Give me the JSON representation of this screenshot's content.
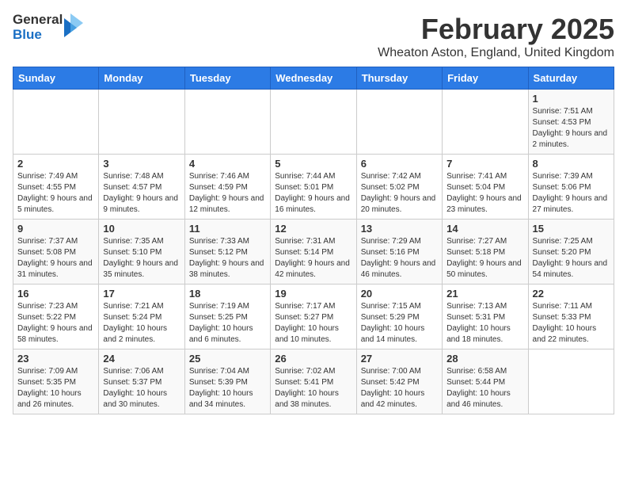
{
  "header": {
    "logo_general": "General",
    "logo_blue": "Blue",
    "month_title": "February 2025",
    "location": "Wheaton Aston, England, United Kingdom"
  },
  "weekdays": [
    "Sunday",
    "Monday",
    "Tuesday",
    "Wednesday",
    "Thursday",
    "Friday",
    "Saturday"
  ],
  "weeks": [
    [
      {
        "day": "",
        "info": ""
      },
      {
        "day": "",
        "info": ""
      },
      {
        "day": "",
        "info": ""
      },
      {
        "day": "",
        "info": ""
      },
      {
        "day": "",
        "info": ""
      },
      {
        "day": "",
        "info": ""
      },
      {
        "day": "1",
        "info": "Sunrise: 7:51 AM\nSunset: 4:53 PM\nDaylight: 9 hours and 2 minutes."
      }
    ],
    [
      {
        "day": "2",
        "info": "Sunrise: 7:49 AM\nSunset: 4:55 PM\nDaylight: 9 hours and 5 minutes."
      },
      {
        "day": "3",
        "info": "Sunrise: 7:48 AM\nSunset: 4:57 PM\nDaylight: 9 hours and 9 minutes."
      },
      {
        "day": "4",
        "info": "Sunrise: 7:46 AM\nSunset: 4:59 PM\nDaylight: 9 hours and 12 minutes."
      },
      {
        "day": "5",
        "info": "Sunrise: 7:44 AM\nSunset: 5:01 PM\nDaylight: 9 hours and 16 minutes."
      },
      {
        "day": "6",
        "info": "Sunrise: 7:42 AM\nSunset: 5:02 PM\nDaylight: 9 hours and 20 minutes."
      },
      {
        "day": "7",
        "info": "Sunrise: 7:41 AM\nSunset: 5:04 PM\nDaylight: 9 hours and 23 minutes."
      },
      {
        "day": "8",
        "info": "Sunrise: 7:39 AM\nSunset: 5:06 PM\nDaylight: 9 hours and 27 minutes."
      }
    ],
    [
      {
        "day": "9",
        "info": "Sunrise: 7:37 AM\nSunset: 5:08 PM\nDaylight: 9 hours and 31 minutes."
      },
      {
        "day": "10",
        "info": "Sunrise: 7:35 AM\nSunset: 5:10 PM\nDaylight: 9 hours and 35 minutes."
      },
      {
        "day": "11",
        "info": "Sunrise: 7:33 AM\nSunset: 5:12 PM\nDaylight: 9 hours and 38 minutes."
      },
      {
        "day": "12",
        "info": "Sunrise: 7:31 AM\nSunset: 5:14 PM\nDaylight: 9 hours and 42 minutes."
      },
      {
        "day": "13",
        "info": "Sunrise: 7:29 AM\nSunset: 5:16 PM\nDaylight: 9 hours and 46 minutes."
      },
      {
        "day": "14",
        "info": "Sunrise: 7:27 AM\nSunset: 5:18 PM\nDaylight: 9 hours and 50 minutes."
      },
      {
        "day": "15",
        "info": "Sunrise: 7:25 AM\nSunset: 5:20 PM\nDaylight: 9 hours and 54 minutes."
      }
    ],
    [
      {
        "day": "16",
        "info": "Sunrise: 7:23 AM\nSunset: 5:22 PM\nDaylight: 9 hours and 58 minutes."
      },
      {
        "day": "17",
        "info": "Sunrise: 7:21 AM\nSunset: 5:24 PM\nDaylight: 10 hours and 2 minutes."
      },
      {
        "day": "18",
        "info": "Sunrise: 7:19 AM\nSunset: 5:25 PM\nDaylight: 10 hours and 6 minutes."
      },
      {
        "day": "19",
        "info": "Sunrise: 7:17 AM\nSunset: 5:27 PM\nDaylight: 10 hours and 10 minutes."
      },
      {
        "day": "20",
        "info": "Sunrise: 7:15 AM\nSunset: 5:29 PM\nDaylight: 10 hours and 14 minutes."
      },
      {
        "day": "21",
        "info": "Sunrise: 7:13 AM\nSunset: 5:31 PM\nDaylight: 10 hours and 18 minutes."
      },
      {
        "day": "22",
        "info": "Sunrise: 7:11 AM\nSunset: 5:33 PM\nDaylight: 10 hours and 22 minutes."
      }
    ],
    [
      {
        "day": "23",
        "info": "Sunrise: 7:09 AM\nSunset: 5:35 PM\nDaylight: 10 hours and 26 minutes."
      },
      {
        "day": "24",
        "info": "Sunrise: 7:06 AM\nSunset: 5:37 PM\nDaylight: 10 hours and 30 minutes."
      },
      {
        "day": "25",
        "info": "Sunrise: 7:04 AM\nSunset: 5:39 PM\nDaylight: 10 hours and 34 minutes."
      },
      {
        "day": "26",
        "info": "Sunrise: 7:02 AM\nSunset: 5:41 PM\nDaylight: 10 hours and 38 minutes."
      },
      {
        "day": "27",
        "info": "Sunrise: 7:00 AM\nSunset: 5:42 PM\nDaylight: 10 hours and 42 minutes."
      },
      {
        "day": "28",
        "info": "Sunrise: 6:58 AM\nSunset: 5:44 PM\nDaylight: 10 hours and 46 minutes."
      },
      {
        "day": "",
        "info": ""
      }
    ]
  ]
}
